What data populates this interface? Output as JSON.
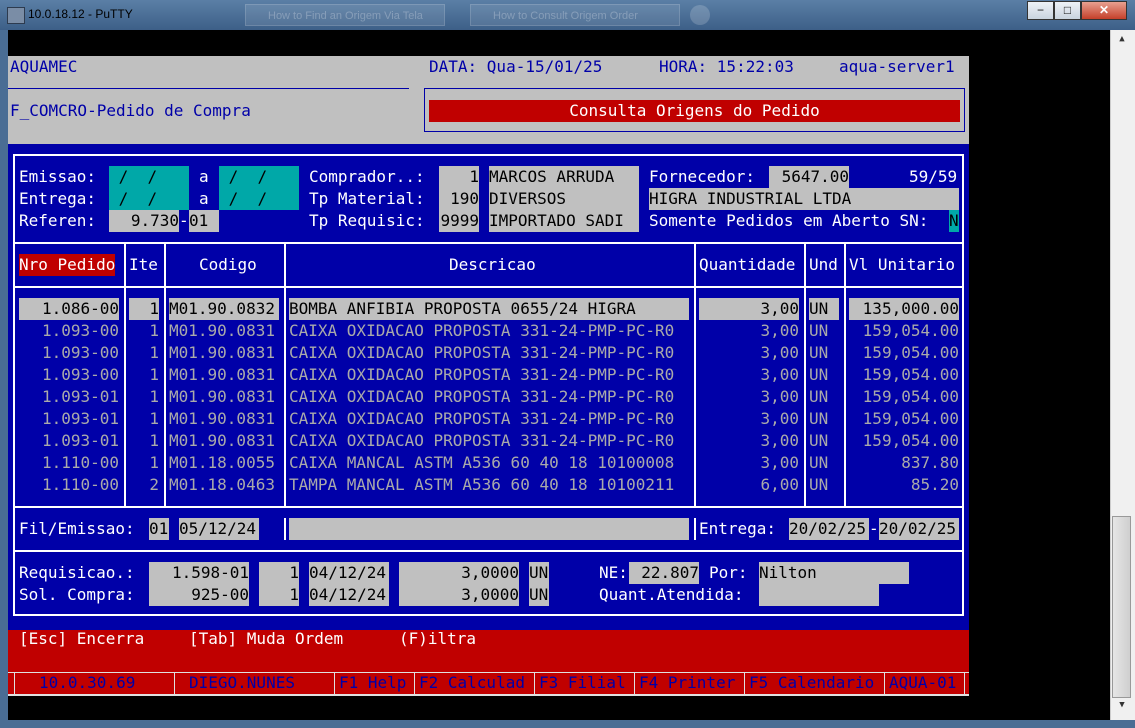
{
  "window": {
    "title": "10.0.18.12 - PuTTY",
    "ghost_tabs": [
      "How to Find an Origem Via Tela",
      "How to Consult Origem Order",
      ""
    ],
    "min_label": "−",
    "max_label": "□",
    "close_label": "✕"
  },
  "header": {
    "company": "AQUAMEC",
    "date": "DATA: Qua-15/01/25",
    "time": "HORA: 15:22:03",
    "server": "aqua-server1",
    "screen_name": "F_COMCRO-Pedido de Compra",
    "screen_title": "Consulta Origens do Pedido"
  },
  "filters": {
    "emissao_label": "Emissao:",
    "entrega_label": "Entrega:",
    "referen_label": "Referen:",
    "date_blank": " /  / ",
    "a": "a",
    "referen_value": "9.730",
    "referen_dash": "-",
    "referen_suffix": "01",
    "comprador_label": "Comprador..:",
    "comprador_code": "1",
    "comprador_name": "MARCOS ARRUDA",
    "tp_material_label": "Tp Material:",
    "tp_material_code": "190",
    "tp_material_name": "DIVERSOS",
    "tp_requisic_label": "Tp Requisic:",
    "tp_requisic_code": "9999",
    "tp_requisic_name": "IMPORTADO SADI",
    "fornecedor_label": "Fornecedor:",
    "fornecedor_code": "5647.00",
    "counter": "59/59",
    "fornecedor_name": "HIGRA INDUSTRIAL LTDA",
    "somente_label": "Somente Pedidos em Aberto SN:",
    "somente_value": "N"
  },
  "table": {
    "headers": [
      "Nro Pedido",
      "Ite",
      "Codigo",
      "Descricao",
      "Quantidade",
      "Und",
      "Vl Unitario"
    ],
    "rows": [
      [
        "1.086-00",
        "1",
        "M01.90.0832",
        "BOMBA ANFIBIA PROPOSTA 0655/24 HIGRA",
        "3,00",
        "UN",
        "135,000.00"
      ],
      [
        "1.093-00",
        "1",
        "M01.90.0831",
        "CAIXA OXIDACAO PROPOSTA 331-24-PMP-PC-R0",
        "3,00",
        "UN",
        "159,054.00"
      ],
      [
        "1.093-00",
        "1",
        "M01.90.0831",
        "CAIXA OXIDACAO PROPOSTA 331-24-PMP-PC-R0",
        "3,00",
        "UN",
        "159,054.00"
      ],
      [
        "1.093-00",
        "1",
        "M01.90.0831",
        "CAIXA OXIDACAO PROPOSTA 331-24-PMP-PC-R0",
        "3,00",
        "UN",
        "159,054.00"
      ],
      [
        "1.093-01",
        "1",
        "M01.90.0831",
        "CAIXA OXIDACAO PROPOSTA 331-24-PMP-PC-R0",
        "3,00",
        "UN",
        "159,054.00"
      ],
      [
        "1.093-01",
        "1",
        "M01.90.0831",
        "CAIXA OXIDACAO PROPOSTA 331-24-PMP-PC-R0",
        "3,00",
        "UN",
        "159,054.00"
      ],
      [
        "1.093-01",
        "1",
        "M01.90.0831",
        "CAIXA OXIDACAO PROPOSTA 331-24-PMP-PC-R0",
        "3,00",
        "UN",
        "159,054.00"
      ],
      [
        "1.110-00",
        "1",
        "M01.18.0055",
        "CAIXA MANCAL ASTM A536 60 40 18 10100008",
        "3,00",
        "UN",
        "837.80"
      ],
      [
        "1.110-00",
        "2",
        "M01.18.0463",
        "TAMPA MANCAL ASTM A536 60 40 18 10100211",
        "6,00",
        "UN",
        "85.20"
      ]
    ]
  },
  "detail": {
    "fil_emissao_label": "Fil/Emissao:",
    "filial": "01",
    "emissao_date": "05/12/24",
    "entrega_label": "Entrega:",
    "entrega_from": "20/02/25",
    "entrega_dash": "-",
    "entrega_to": "20/02/25",
    "requisicao_label": "Requisicao.:",
    "requisicao_num": "1.598-01",
    "requisicao_item": "1",
    "requisicao_date": "04/12/24",
    "requisicao_qty": "3,0000",
    "requisicao_und": "UN",
    "sol_label": "Sol. Compra:",
    "sol_num": "925-00",
    "sol_item": "1",
    "sol_date": "04/12/24",
    "sol_qty": "3,0000",
    "sol_und": "UN",
    "ne_label": "NE:",
    "ne_value": "22.807",
    "por_label": "Por:",
    "por_value": "Nilton",
    "quant_label": "Quant.Atendida:"
  },
  "commands": {
    "esc": "[Esc] Encerra",
    "tab": "[Tab] Muda Ordem",
    "filtra": "(F)iltra"
  },
  "statusbar": {
    "ip": "10.0.30.69",
    "user": "DIEGO.NUNES",
    "f1": "F1 Help",
    "f2": "F2 Calculad",
    "f3": "F3 Filial",
    "f4": "F4 Printer",
    "f5": "F5 Calendario",
    "instance": "AQUA-01"
  },
  "colors": {
    "terminal_blue": "#0000a8",
    "terminal_gray": "#c0c0c0",
    "terminal_red": "#c00000",
    "terminal_cyan": "#00a8a8"
  }
}
